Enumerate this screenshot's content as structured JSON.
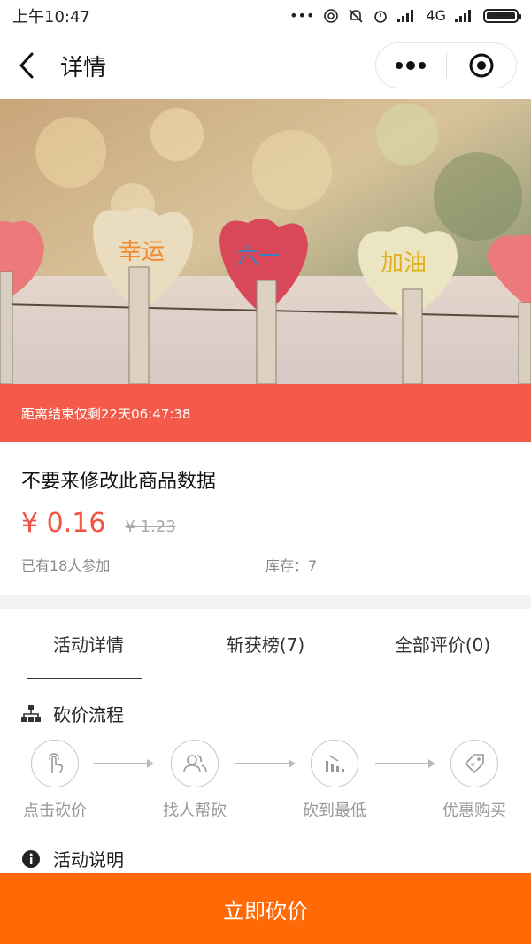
{
  "status_bar": {
    "time": "上午10:47",
    "network": "4G"
  },
  "nav": {
    "title": "详情"
  },
  "hero": {
    "hearts": [
      {
        "text": "幸运"
      },
      {
        "text": "六一"
      },
      {
        "text": "加油"
      }
    ]
  },
  "countdown": {
    "text": "距离结束仅剩22天06:47:38"
  },
  "product": {
    "title": "不要来修改此商品数据",
    "price_now": "¥ 0.16",
    "price_old": "¥ 1.23",
    "participants": "已有18人参加",
    "stock": "库存：7"
  },
  "tabs": [
    {
      "label": "活动详情"
    },
    {
      "label": "斩获榜(7)"
    },
    {
      "label": "全部评价(0)"
    }
  ],
  "process": {
    "title": "砍价流程",
    "steps": [
      {
        "label": "点击砍价",
        "icon": "tap-hand-icon"
      },
      {
        "label": "找人帮砍",
        "icon": "people-icon"
      },
      {
        "label": "砍到最低",
        "icon": "bar-chart-down-icon"
      },
      {
        "label": "优惠购买",
        "icon": "discount-tag-icon"
      }
    ]
  },
  "description": {
    "title": "活动说明"
  },
  "cta": {
    "label": "立即砍价"
  },
  "colors": {
    "accent": "#f45a4a",
    "cta": "#ff6a06",
    "price": "#f25444"
  }
}
